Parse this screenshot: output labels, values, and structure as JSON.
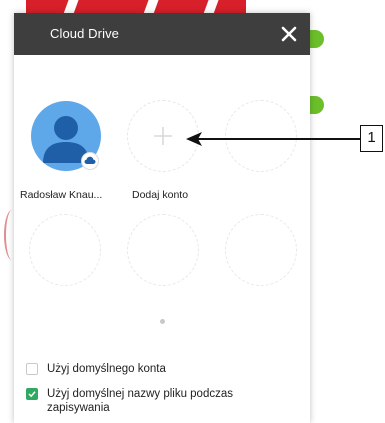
{
  "dialog": {
    "title": "Cloud Drive",
    "close_icon": "close-icon"
  },
  "accounts": [
    {
      "name": "Radosław  Knau...",
      "icon": "user-avatar-icon",
      "badge_icon": "cloud-icon"
    }
  ],
  "add_account": {
    "label": "Dodaj konto",
    "icon": "plus-icon"
  },
  "options": [
    {
      "label": "Użyj domyślnego konta",
      "checked": false
    },
    {
      "label": "Użyj domyślnej nazwy pliku podczas zapisywania",
      "checked": true
    }
  ],
  "callout": {
    "number": "1"
  },
  "colors": {
    "titlebar": "#3e3e3e",
    "avatar": "#5ea8ea",
    "checkbox_checked": "#2fa862"
  }
}
